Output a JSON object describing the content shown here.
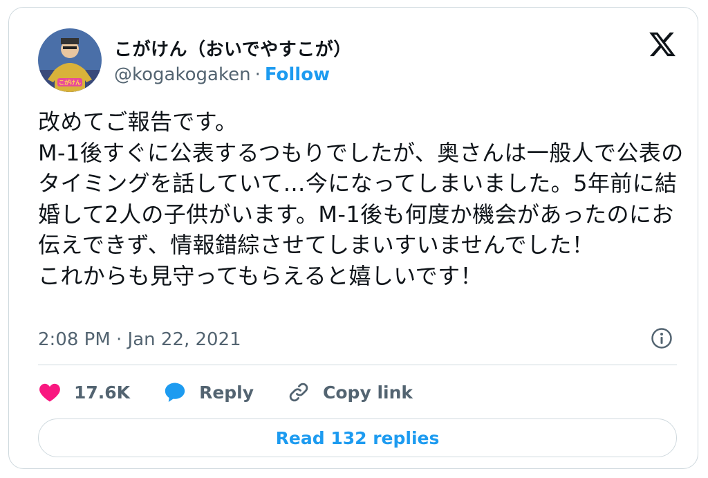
{
  "user": {
    "display_name": "こがけん（おいでやすこが）",
    "handle": "@kogakogaken",
    "separator": "·",
    "follow_label": "Follow"
  },
  "tweet": {
    "text": "改めてご報告です。\nM-1後すぐに公表するつもりでしたが、奥さんは一般人で公表のタイミングを話していて…今になってしまいました。5年前に結婚して2人の子供がいます。M-1後も何度か機会があったのにお伝えできず、情報錯綜させてしまいすいませんでした！\nこれからも見守ってもらえると嬉しいです！",
    "timestamp": "2:08 PM · Jan 22, 2021"
  },
  "actions": {
    "like_count": "17.6K",
    "reply_label": "Reply",
    "copy_link_label": "Copy link"
  },
  "read_replies_label": "Read 132 replies",
  "avatar_badge_text": "こがけん",
  "colors": {
    "accent": "#1d9bf0",
    "like": "#f91880",
    "secondary_text": "#536471",
    "border": "#cfd9de"
  },
  "icons": {
    "brand": "x-logo-icon",
    "info": "info-icon",
    "like": "heart-icon",
    "reply": "speech-bubble-icon",
    "copy": "link-icon"
  }
}
